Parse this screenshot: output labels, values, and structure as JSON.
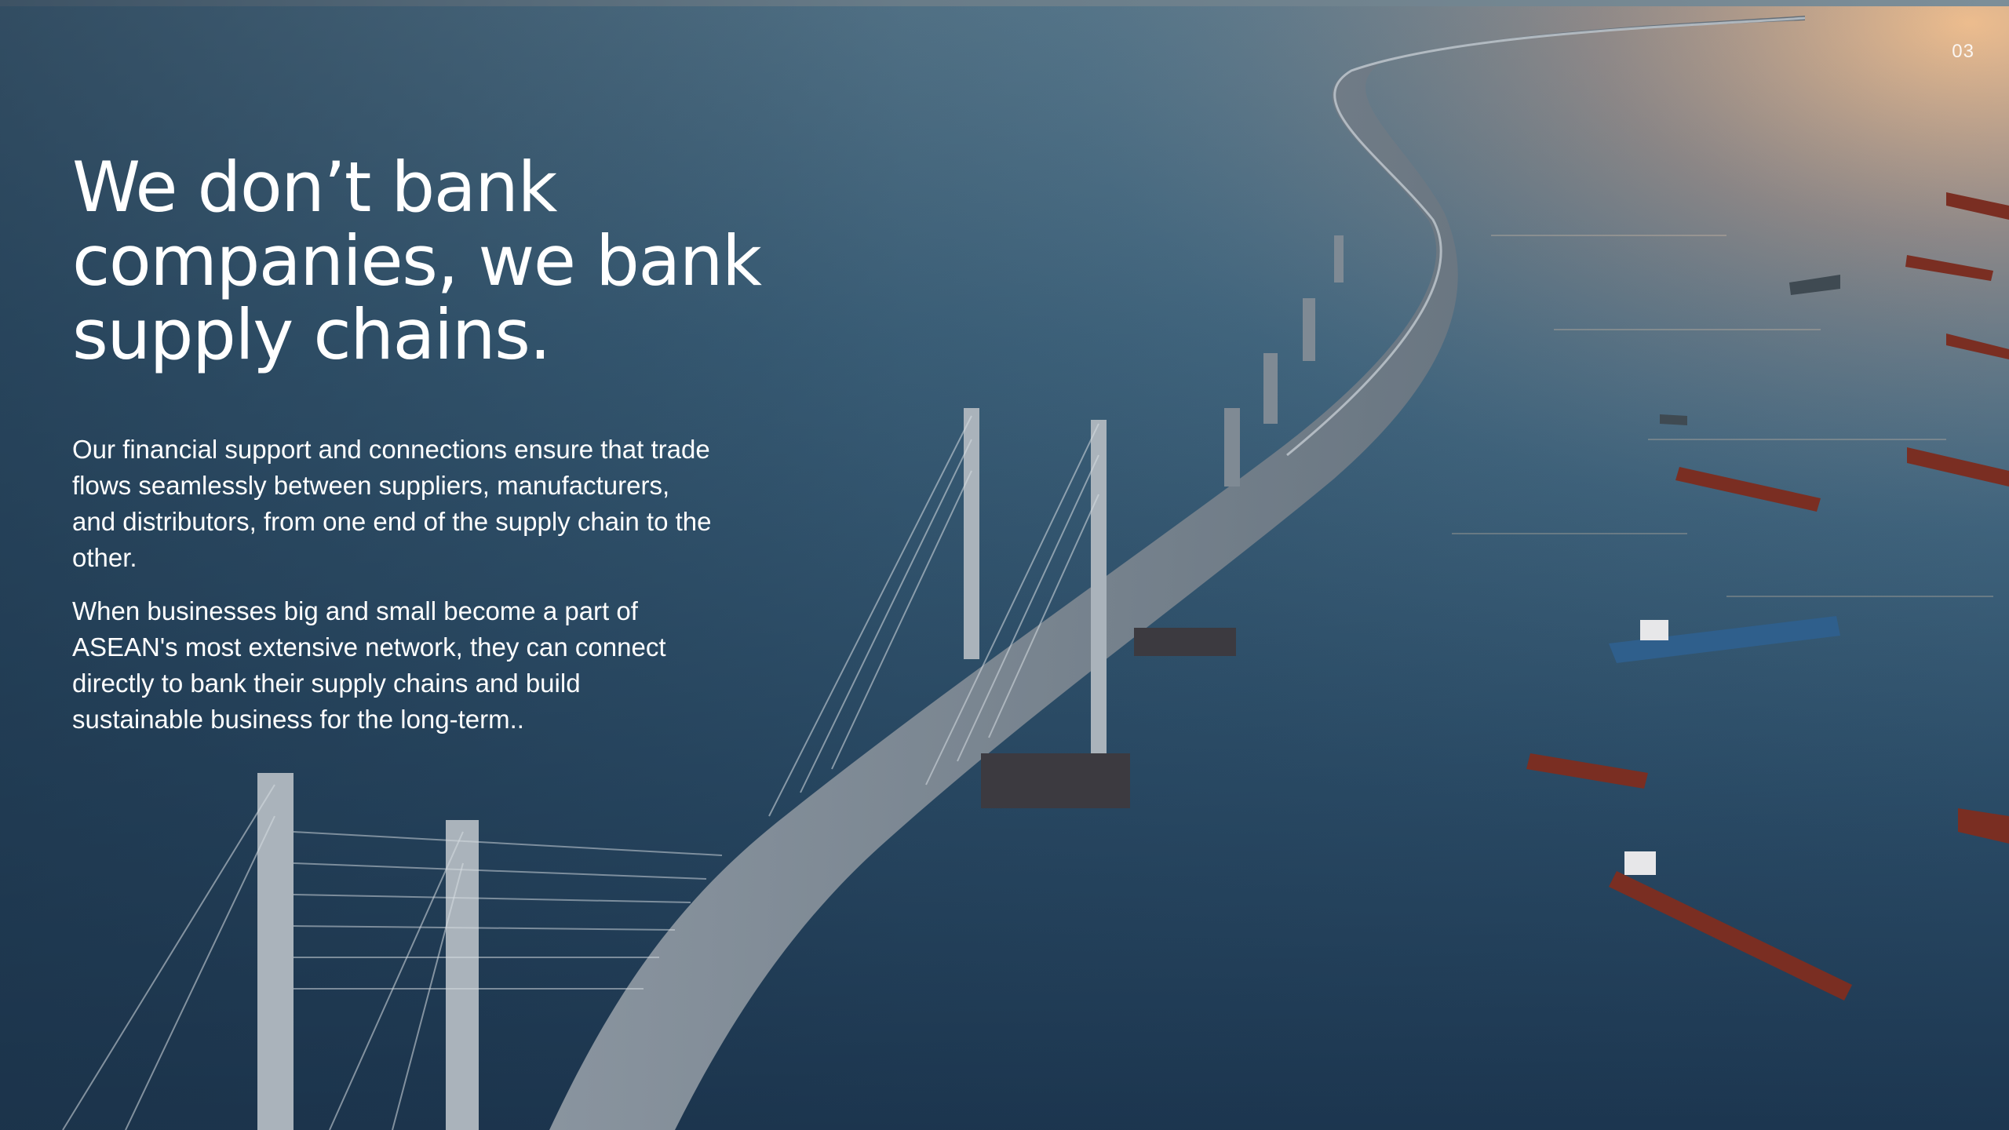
{
  "slide": {
    "page_number": "03",
    "headline_lines": [
      "We don’t bank",
      "companies, we bank",
      "supply chains."
    ],
    "paragraphs": [
      "Our financial support and connections ensure that trade flows seamlessly between suppliers, manufacturers, and distributors, from one end of the supply chain to the other.",
      "When businesses big and small become a part of ASEAN's most extensive network, they can connect directly to bank their supply chains and build sustainable business for the long-term.."
    ]
  },
  "colors": {
    "text": "#ffffff",
    "sea_deep": "#1f3a52",
    "sea_mid": "#3c6480",
    "sunset_glow": "#f2b98a",
    "bridge_concrete": "#9aa4ad",
    "ship_hull": "#7a2e22"
  }
}
